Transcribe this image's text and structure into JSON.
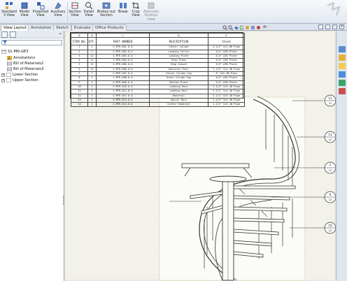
{
  "ribbon": {
    "buttons": [
      {
        "label": "Standard\n3 View",
        "icon": "standard-3-view-icon",
        "enabled": true
      },
      {
        "label": "Model\nView",
        "icon": "model-view-icon",
        "enabled": true
      },
      {
        "label": "Projected\nView",
        "icon": "projected-view-icon",
        "enabled": true
      },
      {
        "label": "Auxiliary\nView",
        "icon": "auxiliary-view-icon",
        "enabled": true
      },
      {
        "label": "Section\nView",
        "icon": "section-view-icon",
        "enabled": true
      },
      {
        "label": "Detail\nView",
        "icon": "detail-view-icon",
        "enabled": true
      },
      {
        "label": "Broken-out\nSection",
        "icon": "broken-out-section-icon",
        "enabled": true
      },
      {
        "label": "Break",
        "icon": "break-icon",
        "enabled": true
      },
      {
        "label": "Crop\nView",
        "icon": "crop-view-icon",
        "enabled": true
      },
      {
        "label": "Alternate\nPosition\nView",
        "icon": "alternate-position-view-icon",
        "enabled": false
      }
    ]
  },
  "tabs": [
    {
      "label": "View Layout",
      "active": true
    },
    {
      "label": "Annotation",
      "active": false
    },
    {
      "label": "Sketch",
      "active": false
    },
    {
      "label": "Evaluate",
      "active": false
    },
    {
      "label": "Office Products",
      "active": false
    }
  ],
  "view_toolbar": {
    "text": "Ar·"
  },
  "tree": {
    "root": "S1-MN-GE3",
    "items": [
      {
        "label": "Annotations",
        "icon": "annotations-folder-icon"
      },
      {
        "label": "Bill of Materials2",
        "icon": "bill-of-materials-icon"
      },
      {
        "label": "Bill of Materials3",
        "icon": "bill-of-materials-icon"
      },
      {
        "label": "Lower Section",
        "icon": "sheet-icon"
      },
      {
        "label": "Upper Section",
        "icon": "sheet-icon"
      }
    ]
  },
  "bom": {
    "letters": [
      "A",
      "B",
      "C",
      "D",
      "E"
    ],
    "headers": [
      "ITEM NO.",
      "QTY.",
      "PART NUMBER",
      "DESCRIPTION",
      "Stock"
    ],
    "rows": [
      [
        "1",
        "1",
        "S-MTR-001-0-A",
        "Center Column",
        "4-1/2\" Sch 80 Pipe"
      ],
      [
        "2",
        "1",
        "S-MTR-002-0-A",
        "Landing Collar",
        "3/4\" A36 Plate"
      ],
      [
        "3",
        "12",
        "S-MTR-003-0-A",
        "Landing Plate",
        "3/4\" A36 Plate"
      ],
      [
        "4",
        "12",
        "S-MTR-004-0-A",
        "Step Plate",
        "3/4\" A36 Plate"
      ],
      [
        "5",
        "12",
        "S-MTR-005-0-A",
        "Step Gusset",
        "3/4\" A36 Plate"
      ],
      [
        "6",
        "12",
        "S-MTR-006-0-A",
        "Baluster Post",
        "1-1/2\" Sch 40 Pipe"
      ],
      [
        "7",
        "1",
        "S-MTR-007-0-A",
        "Center Column Cap",
        "4\" Sch 80 Pipe"
      ],
      [
        "8",
        "1",
        "S-MTR-008-0-A",
        "Outer Column Cap",
        "3/4\" A36 Plate"
      ],
      [
        "9",
        "1",
        "S-MTR-009-0-A",
        "Bottom Plate",
        "3/4\" A36 Plate"
      ],
      [
        "10",
        "1",
        "S-MTR-010-0-A",
        "Landing Post",
        "1-1/2\" Sch 40 Pipe"
      ],
      [
        "11",
        "1",
        "S-MTR-011-0-A",
        "Landing Rail",
        "1-1/2\" Sch 40 Pipe"
      ],
      [
        "12",
        "1",
        "S-MTR-012-0-A",
        "Handrail",
        "1-1/2\" Sch 40 Pipe"
      ],
      [
        "13",
        "1",
        "S-MTR-013-0-A",
        "Spiral Rail",
        "1-1/2\" Sch 40 Pipe"
      ],
      [
        "14",
        "1",
        "S-MTR-014-0-A",
        "Center Handrail",
        "1-1/2\" Sch 40 Pipe"
      ]
    ]
  },
  "detail_callouts": [
    {
      "num": "11",
      "sub": "12"
    },
    {
      "num": "13",
      "sub": "12"
    },
    {
      "num": "7",
      "sub": "12"
    },
    {
      "num": "6",
      "sub": "12"
    },
    {
      "num": "10",
      "sub": "12"
    }
  ]
}
